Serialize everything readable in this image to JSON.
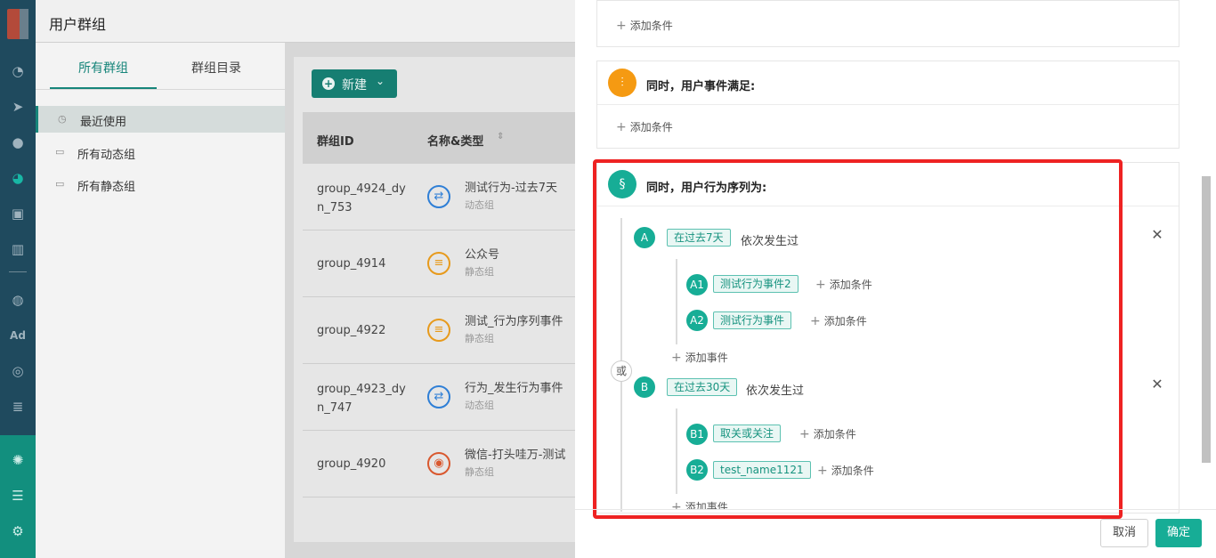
{
  "rail": {
    "icons": [
      "dashboard-icon",
      "send-icon",
      "user-icon",
      "user-group-icon",
      "bookmark-icon",
      "bar-chart-icon",
      "wechat-icon",
      "ad-icon",
      "target-icon",
      "list-icon",
      "network-icon",
      "server-icon",
      "gear-icon"
    ],
    "ad_label": "Ad"
  },
  "page": {
    "title": "用户群组",
    "tabs": [
      "所有群组",
      "群组目录"
    ],
    "nav": [
      "最近使用",
      "所有动态组",
      "所有静态组"
    ],
    "new_button": "新建",
    "columns": [
      "群组ID",
      "名称&类型"
    ],
    "rows": [
      {
        "id": "group_4924_dyn_753",
        "name": "测试行为-过去7天",
        "type": "动态组"
      },
      {
        "id": "group_4914",
        "name": "公众号",
        "type": "静态组"
      },
      {
        "id": "group_4922",
        "name": "测试_行为序列事件",
        "type": "静态组"
      },
      {
        "id": "group_4923_dyn_747",
        "name": "行为_发生行为事件",
        "type": "动态组"
      },
      {
        "id": "group_4920",
        "name": "微信-打头哇万-测试",
        "type": "静态组"
      }
    ]
  },
  "drawer": {
    "add_condition": "添加条件",
    "add_event": "添加事件",
    "event_section_title": "同时，用户事件满足:",
    "sequence_section_title": "同时，用户行为序列为:",
    "or_label": "或",
    "sequences": [
      {
        "letter": "A",
        "time": "在过去7天",
        "text": "依次发生过",
        "steps": [
          {
            "label": "A1",
            "event": "测试行为事件2"
          },
          {
            "label": "A2",
            "event": "测试行为事件"
          }
        ]
      },
      {
        "letter": "B",
        "time": "在过去30天",
        "text": "依次发生过",
        "steps": [
          {
            "label": "B1",
            "event": "取关或关注"
          },
          {
            "label": "B2",
            "event": "test_name1121"
          }
        ]
      }
    ],
    "cancel": "取消",
    "confirm": "确定"
  },
  "colors": {
    "accent": "#17ad96",
    "highlight": "#ee2222",
    "event_icon": "#f59a12"
  }
}
